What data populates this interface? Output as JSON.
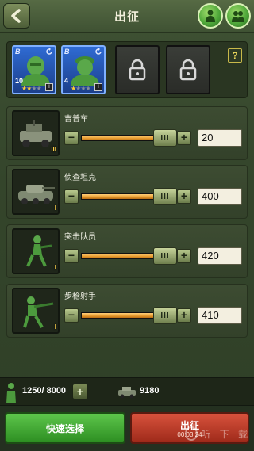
{
  "header": {
    "title": "出征",
    "back_icon": "back-arrow-icon",
    "buttons": [
      {
        "name": "soldier-shield-icon"
      },
      {
        "name": "soldier-group-icon"
      }
    ]
  },
  "squad": {
    "heroes": [
      {
        "rank": "B",
        "level": "10",
        "stars_on": "★★",
        "stars_off": "★★",
        "badge": "I"
      },
      {
        "rank": "B",
        "level": "4",
        "stars_on": "★",
        "stars_off": "★★★",
        "badge": "I"
      }
    ],
    "locked_slots": 2,
    "help_label": "?"
  },
  "units": [
    {
      "name": "吉普车",
      "rank_mark": "III",
      "slider_fraction": 0.96,
      "handle_label": "III",
      "count": "20"
    },
    {
      "name": "侦查坦克",
      "rank_mark": "I",
      "slider_fraction": 0.96,
      "handle_label": "III",
      "count": "400"
    },
    {
      "name": "突击队员",
      "rank_mark": "I",
      "slider_fraction": 0.96,
      "handle_label": "III",
      "count": "420"
    },
    {
      "name": "步枪射手",
      "rank_mark": "I",
      "slider_fraction": 0.96,
      "handle_label": "III",
      "count": "410"
    }
  ],
  "controls": {
    "minus": "−",
    "plus": "+"
  },
  "status": {
    "population": "1250/ 8000",
    "add_label": "+",
    "resource": "9180"
  },
  "actions": {
    "quick_select": "快速选择",
    "deploy": "出征",
    "deploy_timer": "00:03:24"
  },
  "watermark": "听 下 载",
  "colors": {
    "accent_green": "#2d8e22",
    "deploy_red": "#9e2a1a",
    "slider_orange": "#e69a2e",
    "hero_blue": "#2f6bd3"
  }
}
